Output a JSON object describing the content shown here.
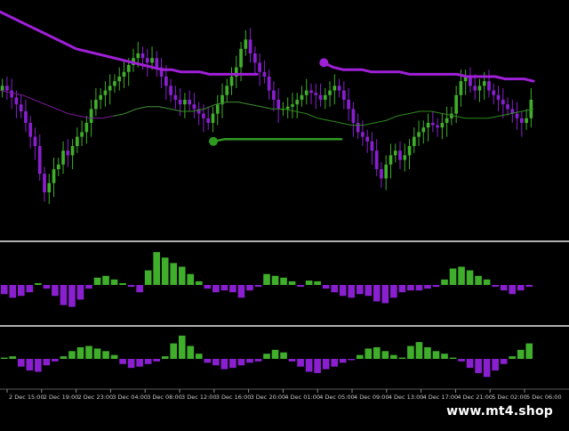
{
  "colors": {
    "background": "#000000",
    "bull": "#3fae2a",
    "bear": "#8a1fd0",
    "upper_line": "#a020d8",
    "mid_line_purple": "#7a1a9a",
    "mid_line_green": "#2f8a1e",
    "green_marker": "#2f9a22",
    "separator": "#b0b0b0",
    "axis_text": "#c8c8c8"
  },
  "x_axis": {
    "tick_labels": [
      "2 Dec 15:00",
      "2 Dec 19:00",
      "2 Dec 23:00",
      "3 Dec 04:00",
      "3 Dec 08:00",
      "3 Dec 12:00",
      "3 Dec 16:00",
      "3 Dec 20:00",
      "4 Dec 01:00",
      "4 Dec 05:00",
      "4 Dec 09:00",
      "4 Dec 13:00",
      "4 Dec 17:00",
      "4 Dec 21:00",
      "5 Dec 02:00",
      "5 Dec 06:00"
    ]
  },
  "watermark": "www.mt4.shop",
  "chart_data": [
    {
      "type": "line",
      "panel": "price",
      "title": "",
      "xlabel": "",
      "ylabel": "",
      "grid": false,
      "y_ticks_visible": false,
      "ylim": [
        0,
        100
      ],
      "candles_close": [
        66,
        64,
        61,
        58,
        55,
        50,
        44,
        40,
        28,
        20,
        24,
        30,
        32,
        38,
        36,
        40,
        44,
        46,
        50,
        56,
        60,
        62,
        64,
        66,
        68,
        70,
        72,
        75,
        78,
        80,
        78,
        76,
        78,
        74,
        70,
        66,
        62,
        60,
        58,
        60,
        58,
        56,
        54,
        52,
        50,
        54,
        58,
        62,
        66,
        70,
        74,
        82,
        86,
        80,
        76,
        72,
        70,
        64,
        60,
        56,
        56,
        57,
        58,
        60,
        62,
        64,
        63,
        62,
        60,
        62,
        64,
        66,
        64,
        60,
        56,
        50,
        46,
        44,
        42,
        38,
        30,
        26,
        32,
        36,
        38,
        34,
        36,
        40,
        44,
        46,
        48,
        50,
        49,
        48,
        50,
        52,
        54,
        62,
        68,
        70,
        66,
        64,
        66,
        68,
        64,
        62,
        60,
        58,
        56,
        54,
        52,
        50,
        52,
        60
      ],
      "series": [
        {
          "name": "",
          "color": "upper_line",
          "style": "thick",
          "values": [
            98,
            96,
            94,
            92,
            90,
            88,
            86,
            84,
            82,
            81,
            80,
            79,
            78,
            77,
            76,
            75,
            74,
            73,
            73,
            72,
            72,
            72,
            71,
            71,
            71,
            71,
            71,
            71,
            null,
            null,
            null,
            null,
            null,
            null,
            76,
            74,
            73,
            73,
            73,
            72,
            72,
            72,
            72,
            71,
            71,
            71,
            71,
            71,
            71,
            70,
            70,
            70,
            70,
            69,
            69,
            69,
            68
          ]
        },
        {
          "name": "",
          "color": "mid_line",
          "style": "thin",
          "values": [
            64,
            63,
            62,
            60,
            58,
            56,
            54,
            53,
            52,
            52,
            53,
            54,
            56,
            57,
            57,
            56,
            55,
            55,
            56,
            58,
            59,
            59,
            58,
            57,
            56,
            56,
            55,
            54,
            52,
            51,
            50,
            49,
            49,
            50,
            51,
            53,
            54,
            55,
            55,
            54,
            53,
            52,
            52,
            52,
            53,
            54,
            55,
            56
          ]
        },
        {
          "name": "",
          "color": "green_marker",
          "style": "dot-line",
          "values": [
            42,
            43,
            43,
            43,
            43,
            43,
            43,
            43,
            43,
            43,
            43,
            43
          ]
        }
      ]
    },
    {
      "type": "bar",
      "panel": "histogram-1",
      "title": "",
      "ylim": [
        -1,
        1
      ],
      "y_ticks_visible": false,
      "values": [
        -0.25,
        -0.35,
        -0.3,
        -0.2,
        0.05,
        -0.1,
        -0.3,
        -0.55,
        -0.6,
        -0.4,
        -0.1,
        0.2,
        0.25,
        0.15,
        0.05,
        -0.05,
        -0.2,
        0.4,
        0.9,
        0.75,
        0.6,
        0.5,
        0.3,
        0.1,
        -0.1,
        -0.2,
        -0.15,
        -0.2,
        -0.35,
        -0.15,
        -0.05,
        0.3,
        0.25,
        0.2,
        0.1,
        -0.05,
        0.12,
        0.1,
        -0.1,
        -0.2,
        -0.3,
        -0.35,
        -0.25,
        -0.3,
        -0.45,
        -0.5,
        -0.35,
        -0.2,
        -0.15,
        -0.15,
        -0.1,
        -0.05,
        0.15,
        0.45,
        0.5,
        0.4,
        0.25,
        0.15,
        -0.05,
        -0.15,
        -0.25,
        -0.15,
        -0.05
      ]
    },
    {
      "type": "bar",
      "panel": "histogram-2",
      "title": "",
      "ylim": [
        -1,
        1
      ],
      "y_ticks_visible": false,
      "values": [
        0.05,
        0.1,
        -0.3,
        -0.45,
        -0.5,
        -0.25,
        -0.1,
        0.1,
        0.3,
        0.45,
        0.5,
        0.4,
        0.3,
        0.15,
        -0.2,
        -0.35,
        -0.3,
        -0.2,
        -0.1,
        0.1,
        0.6,
        0.9,
        0.5,
        0.2,
        -0.15,
        -0.25,
        -0.4,
        -0.35,
        -0.25,
        -0.15,
        -0.1,
        0.2,
        0.35,
        0.25,
        -0.1,
        -0.3,
        -0.5,
        -0.55,
        -0.4,
        -0.3,
        -0.15,
        -0.05,
        0.15,
        0.4,
        0.45,
        0.3,
        0.15,
        0.05,
        0.5,
        0.65,
        0.45,
        0.3,
        0.2,
        0.05,
        -0.1,
        -0.35,
        -0.55,
        -0.7,
        -0.45,
        -0.2,
        0.1,
        0.35,
        0.6
      ]
    }
  ]
}
